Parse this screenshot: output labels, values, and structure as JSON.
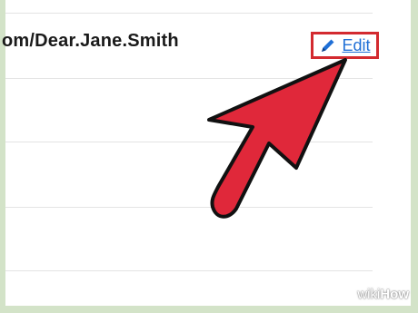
{
  "profile": {
    "url_fragment": "om/Dear.Jane.Smith",
    "edit_label": "Edit"
  },
  "watermark": {
    "wiki": "wiki",
    "how": "How"
  },
  "colors": {
    "accent_red": "#d32a2f",
    "link_blue": "#1f6fd6",
    "frame_green": "#d3e3c8"
  },
  "icons": {
    "edit": "pencil-icon",
    "pointer": "cursor-arrow-icon"
  }
}
